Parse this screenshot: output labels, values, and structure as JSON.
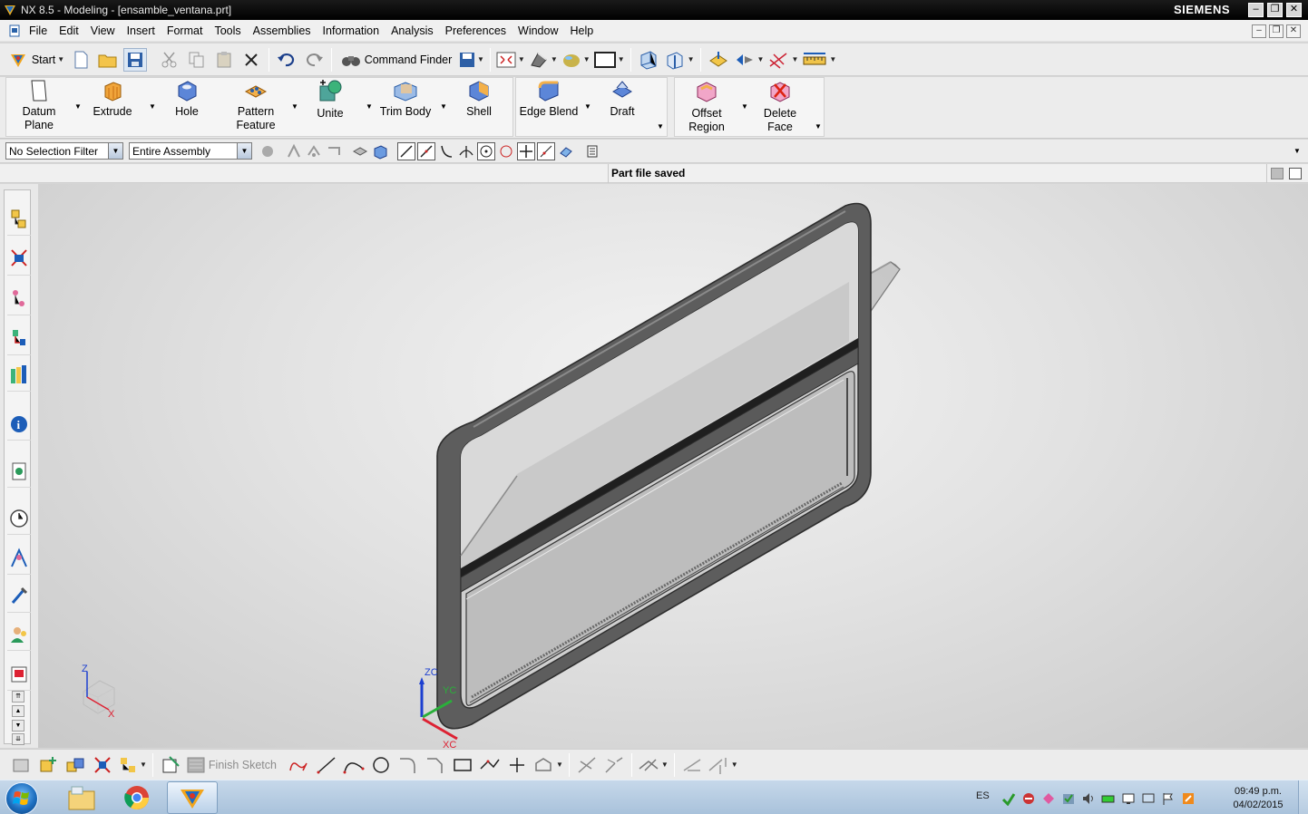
{
  "window": {
    "title": "NX 8.5 - Modeling - [ensamble_ventana.prt]",
    "brand": "SIEMENS"
  },
  "menu": [
    "File",
    "Edit",
    "View",
    "Insert",
    "Format",
    "Tools",
    "Assemblies",
    "Information",
    "Analysis",
    "Preferences",
    "Window",
    "Help"
  ],
  "toolbar": {
    "start_label": "Start",
    "command_finder_label": "Command Finder"
  },
  "ribbon": {
    "commands": [
      {
        "label1": "Datum",
        "label2": "Plane"
      },
      {
        "label1": "Extrude",
        "label2": ""
      },
      {
        "label1": "Hole",
        "label2": ""
      },
      {
        "label1": "Pattern",
        "label2": "Feature"
      },
      {
        "label1": "Unite",
        "label2": ""
      },
      {
        "label1": "Trim Body",
        "label2": ""
      },
      {
        "label1": "Shell",
        "label2": ""
      },
      {
        "label1": "Edge Blend",
        "label2": ""
      },
      {
        "label1": "Draft",
        "label2": ""
      },
      {
        "label1": "Offset",
        "label2": "Region"
      },
      {
        "label1": "Delete",
        "label2": "Face"
      }
    ]
  },
  "selection": {
    "filter_value": "No Selection Filter",
    "scope_value": "Entire Assembly"
  },
  "status": {
    "message": "Part file saved"
  },
  "viewport": {
    "triad": {
      "z": "Z",
      "x": "X"
    },
    "wcs": {
      "zc": "ZC",
      "yc": "YC",
      "xc": "XC"
    }
  },
  "sketch_toolbar": {
    "finish_sketch_label": "Finish Sketch"
  },
  "taskbar": {
    "language": "ES",
    "time": "09:49 p.m.",
    "date": "04/02/2015"
  }
}
